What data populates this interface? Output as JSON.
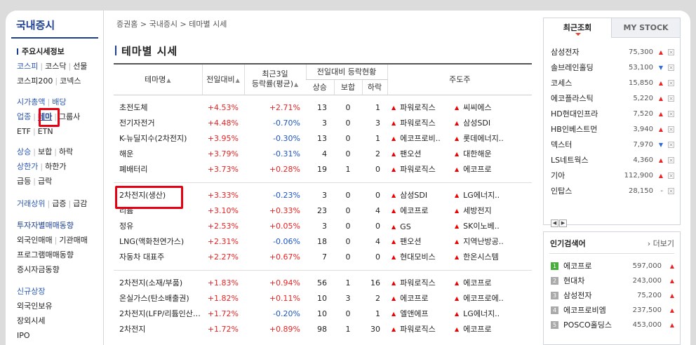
{
  "sidebar": {
    "title": "국내증시",
    "sections": [
      {
        "head": "주요시세정보",
        "rows": [
          [
            "코스피",
            "코스닥",
            "선물"
          ],
          [
            "코스피200",
            "코넥스"
          ]
        ]
      },
      {
        "rows": [
          [
            "시가총액",
            "배당"
          ],
          [
            "업종",
            "테마",
            "그룹사"
          ],
          [
            "ETF",
            "ETN"
          ]
        ]
      },
      {
        "rows": [
          [
            "상승",
            "보합",
            "하락"
          ],
          [
            "상한가",
            "하한가"
          ],
          [
            "급등",
            "급락"
          ]
        ]
      },
      {
        "rows": [
          [
            "거래상위",
            "급증",
            "급감"
          ]
        ]
      },
      {
        "rows": [
          [
            "투자자별매매동향"
          ],
          [
            "외국인매매",
            "기관매매"
          ],
          [
            "프로그램매매동향"
          ],
          [
            "증시자금동향"
          ]
        ]
      },
      {
        "rows": [
          [
            "신규상장"
          ],
          [
            "외국인보유"
          ],
          [
            "장외시세"
          ],
          [
            "IPO"
          ]
        ]
      }
    ]
  },
  "breadcrumb": "증권홈 > 국내증시 > 테마별 시세",
  "page_title": "테마별 시세",
  "table": {
    "headers": {
      "name": "테마명",
      "change": "전일대비",
      "recent3_l1": "최근3일",
      "recent3_l2": "등락률(평균)",
      "status": "전일대비 등락현황",
      "up": "상승",
      "flat": "보합",
      "down": "하락",
      "leaders": "주도주"
    },
    "groups": [
      [
        {
          "name": "초전도체",
          "chg": "+4.53%",
          "r3": "+2.71%",
          "up": "13",
          "flat": "0",
          "dn": "1",
          "l1": "파워로직스",
          "l2": "씨씨에스"
        },
        {
          "name": "전기자전거",
          "chg": "+4.48%",
          "r3": "-0.70%",
          "up": "3",
          "flat": "0",
          "dn": "3",
          "l1": "파워로직스",
          "l2": "삼성SDI"
        },
        {
          "name": "K-뉴딜지수(2차전지)",
          "chg": "+3.95%",
          "r3": "-0.30%",
          "up": "13",
          "flat": "0",
          "dn": "1",
          "l1": "에코프로비..",
          "l2": "롯데에너지.."
        },
        {
          "name": "해운",
          "chg": "+3.79%",
          "r3": "-0.31%",
          "up": "4",
          "flat": "0",
          "dn": "2",
          "l1": "팬오션",
          "l2": "대한해운"
        },
        {
          "name": "폐배터리",
          "chg": "+3.73%",
          "r3": "+0.28%",
          "up": "19",
          "flat": "1",
          "dn": "0",
          "l1": "파워로직스",
          "l2": "에코프로"
        }
      ],
      [
        {
          "name": "2차전지(생산)",
          "chg": "+3.33%",
          "r3": "-0.23%",
          "up": "3",
          "flat": "0",
          "dn": "0",
          "l1": "삼성SDI",
          "l2": "LG에너지.."
        },
        {
          "name": "리튬",
          "chg": "+3.10%",
          "r3": "+0.33%",
          "up": "23",
          "flat": "0",
          "dn": "4",
          "l1": "에코프로",
          "l2": "세방전지"
        },
        {
          "name": "정유",
          "chg": "+2.53%",
          "r3": "+0.05%",
          "up": "3",
          "flat": "0",
          "dn": "0",
          "l1": "GS",
          "l2": "SK이노베.."
        },
        {
          "name": "LNG(액화천연가스)",
          "chg": "+2.31%",
          "r3": "-0.06%",
          "up": "18",
          "flat": "0",
          "dn": "4",
          "l1": "팬오션",
          "l2": "지역난방공.."
        },
        {
          "name": "자동차 대표주",
          "chg": "+2.27%",
          "r3": "+0.67%",
          "up": "7",
          "flat": "0",
          "dn": "0",
          "l1": "현대모비스",
          "l2": "한온시스템"
        }
      ],
      [
        {
          "name": "2차전지(소재/부품)",
          "chg": "+1.83%",
          "r3": "+0.94%",
          "up": "56",
          "flat": "1",
          "dn": "16",
          "l1": "파워로직스",
          "l2": "에코프로"
        },
        {
          "name": "온실가스(탄소배출권)",
          "chg": "+1.82%",
          "r3": "+0.11%",
          "up": "10",
          "flat": "3",
          "dn": "2",
          "l1": "에코프로",
          "l2": "에코프로에.."
        },
        {
          "name": "2차전지(LFP/리튬인산…",
          "chg": "+1.72%",
          "r3": "-0.20%",
          "up": "10",
          "flat": "0",
          "dn": "1",
          "l1": "엘앤에프",
          "l2": "LG에너지.."
        },
        {
          "name": "2차전지",
          "chg": "+1.72%",
          "r3": "+0.89%",
          "up": "98",
          "flat": "1",
          "dn": "30",
          "l1": "파워로직스",
          "l2": "에코프로"
        }
      ]
    ]
  },
  "recent_panel": {
    "tab_recent": "최근조회",
    "tab_mystock": "MY STOCK",
    "items": [
      {
        "name": "삼성전자",
        "price": "75,300",
        "dir": "up"
      },
      {
        "name": "솔브레인홀딩",
        "price": "53,100",
        "dir": "dn"
      },
      {
        "name": "코세스",
        "price": "15,850",
        "dir": "up"
      },
      {
        "name": "에코플라스틱",
        "price": "5,220",
        "dir": "up"
      },
      {
        "name": "HD현대인프라",
        "price": "7,520",
        "dir": "up"
      },
      {
        "name": "HB인베스트먼",
        "price": "3,940",
        "dir": "up"
      },
      {
        "name": "덱스터",
        "price": "7,970",
        "dir": "dn"
      },
      {
        "name": "LS네트웍스",
        "price": "4,360",
        "dir": "up"
      },
      {
        "name": "기아",
        "price": "112,900",
        "dir": "up"
      },
      {
        "name": "인탑스",
        "price": "28,150",
        "dir": "flat"
      }
    ]
  },
  "popular": {
    "title": "인기검색어",
    "more": "더보기",
    "items": [
      {
        "rank": "1",
        "name": "에코프로",
        "price": "597,000"
      },
      {
        "rank": "2",
        "name": "현대차",
        "price": "243,000"
      },
      {
        "rank": "3",
        "name": "삼성전자",
        "price": "75,200"
      },
      {
        "rank": "4",
        "name": "에코프로비엠",
        "price": "237,500"
      },
      {
        "rank": "5",
        "name": "POSCO홀딩스",
        "price": "453,000"
      }
    ]
  },
  "colors": {
    "highlight": "#e60012",
    "up": "#e22222",
    "down": "#1c55c8",
    "brand": "#1c3f94"
  }
}
